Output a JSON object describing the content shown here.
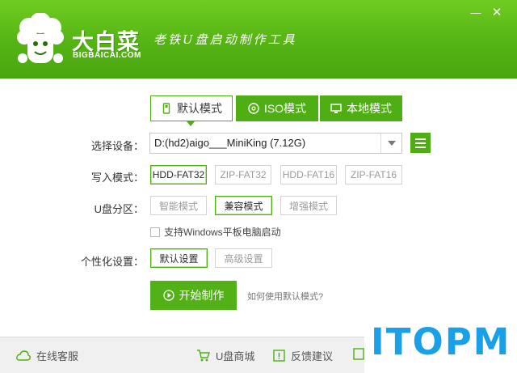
{
  "header": {
    "brand_name": "大白菜",
    "brand_domain": "BIGBAICAI.COM",
    "slogan": "老铁U盘启动制作工具",
    "minimize_glyph": "—",
    "close_glyph": "✕"
  },
  "tabs": [
    {
      "label": "默认模式",
      "icon": "usb-drive-icon",
      "active": true
    },
    {
      "label": "ISO模式",
      "icon": "disc-icon",
      "active": false
    },
    {
      "label": "本地模式",
      "icon": "monitor-icon",
      "active": false
    }
  ],
  "device": {
    "label": "选择设备：",
    "value": "D:(hd2)aigo___MiniKing (7.12G)"
  },
  "write_mode": {
    "label": "写入模式：",
    "options": [
      "HDD-FAT32",
      "ZIP-FAT32",
      "HDD-FAT16",
      "ZIP-FAT16"
    ],
    "selected": "HDD-FAT32"
  },
  "partition": {
    "label": "U盘分区：",
    "options": [
      "智能模式",
      "兼容模式",
      "增强模式"
    ],
    "selected": "兼容模式"
  },
  "windows_tablet_checkbox": {
    "label": "支持Windows平板电脑启动",
    "checked": false
  },
  "personalize": {
    "label": "个性化设置：",
    "options": [
      "默认设置",
      "高级设置"
    ],
    "selected": "默认设置"
  },
  "start_button": "开始制作",
  "help_link": "如何使用默认模式?",
  "footer": {
    "support": "在线客服",
    "shop": "U盘商城",
    "feedback": "反馈建议"
  },
  "watermark": "ITOPM",
  "colors": {
    "accent": "#4fae14",
    "watermark": "#1aa0e6"
  }
}
